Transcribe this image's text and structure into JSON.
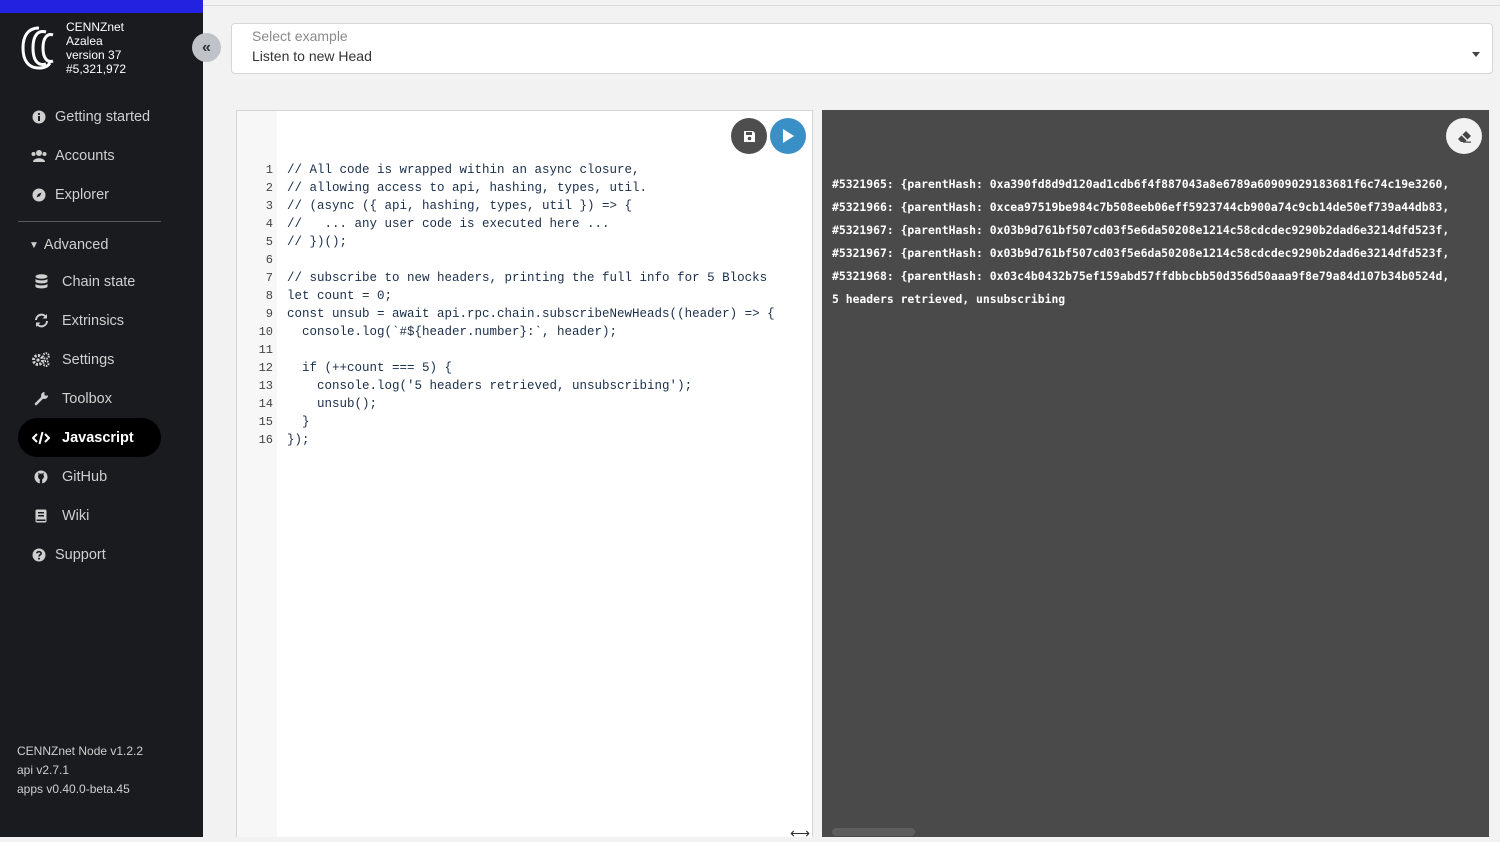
{
  "sidebar": {
    "chain": {
      "name": "CENNZnet",
      "network": "Azalea",
      "version": "version 37",
      "block": "#5,321,972"
    },
    "nav": [
      {
        "label": "Getting started",
        "icon": "info-icon"
      },
      {
        "label": "Accounts",
        "icon": "users-icon"
      },
      {
        "label": "Explorer",
        "icon": "compass-icon"
      }
    ],
    "advanced_label": "Advanced",
    "advanced": [
      {
        "label": "Chain state",
        "icon": "database-icon"
      },
      {
        "label": "Extrinsics",
        "icon": "sync-icon"
      },
      {
        "label": "Settings",
        "icon": "cogs-icon"
      },
      {
        "label": "Toolbox",
        "icon": "wrench-icon"
      },
      {
        "label": "Javascript",
        "icon": "code-icon",
        "active": true
      },
      {
        "label": "GitHub",
        "icon": "github-icon"
      },
      {
        "label": "Wiki",
        "icon": "book-icon"
      },
      {
        "label": "Support",
        "icon": "question-icon"
      }
    ],
    "versions": {
      "node": "CENNZnet Node  v1.2.2",
      "api": "api v2.7.1",
      "apps": "apps v0.40.0-beta.45"
    }
  },
  "main": {
    "example_select": {
      "label": "Select example",
      "value": "Listen to new Head"
    },
    "editor": {
      "line_numbers": [
        "1",
        "2",
        "3",
        "4",
        "5",
        "6",
        "7",
        "8",
        "9",
        "10",
        "11",
        "12",
        "13",
        "14",
        "15",
        "16"
      ],
      "lines": [
        "// All code is wrapped within an async closure,",
        "// allowing access to api, hashing, types, util.",
        "// (async ({ api, hashing, types, util }) => {",
        "//   ... any user code is executed here ...",
        "// })();",
        "",
        "// subscribe to new headers, printing the full info for 5 Blocks",
        "let count = 0;",
        "const unsub = await api.rpc.chain.subscribeNewHeads((header) => {",
        "  console.log(`#${header.number}:`, header);",
        "",
        "  if (++count === 5) {",
        "    console.log('5 headers retrieved, unsubscribing');",
        "    unsub();",
        "  }",
        "});"
      ]
    },
    "output": {
      "lines": [
        "#5321965: {parentHash: 0xa390fd8d9d120ad1cdb6f4f887043a8e6789a60909029183681f6c74c19e3260,",
        "#5321966: {parentHash: 0xcea97519be984c7b508eeb06eff5923744cb900a74c9cb14de50ef739a44db83,",
        "#5321967: {parentHash: 0x03b9d761bf507cd03f5e6da50208e1214c58cdcdec9290b2dad6e3214dfd523f,",
        "#5321967: {parentHash: 0x03b9d761bf507cd03f5e6da50208e1214c58cdcdec9290b2dad6e3214dfd523f,",
        "#5321968: {parentHash: 0x03c4b0432b75ef159abd57ffdbbcbb50d356d50aaa9f8e79a84d107b34b0524d,",
        "5 headers retrieved, unsubscribing"
      ]
    }
  },
  "colors": {
    "sidebar_bg": "#1a1b1e",
    "top_accent": "#2222e0",
    "run_button": "#3b8fc7",
    "output_bg": "#4a4a4a"
  }
}
